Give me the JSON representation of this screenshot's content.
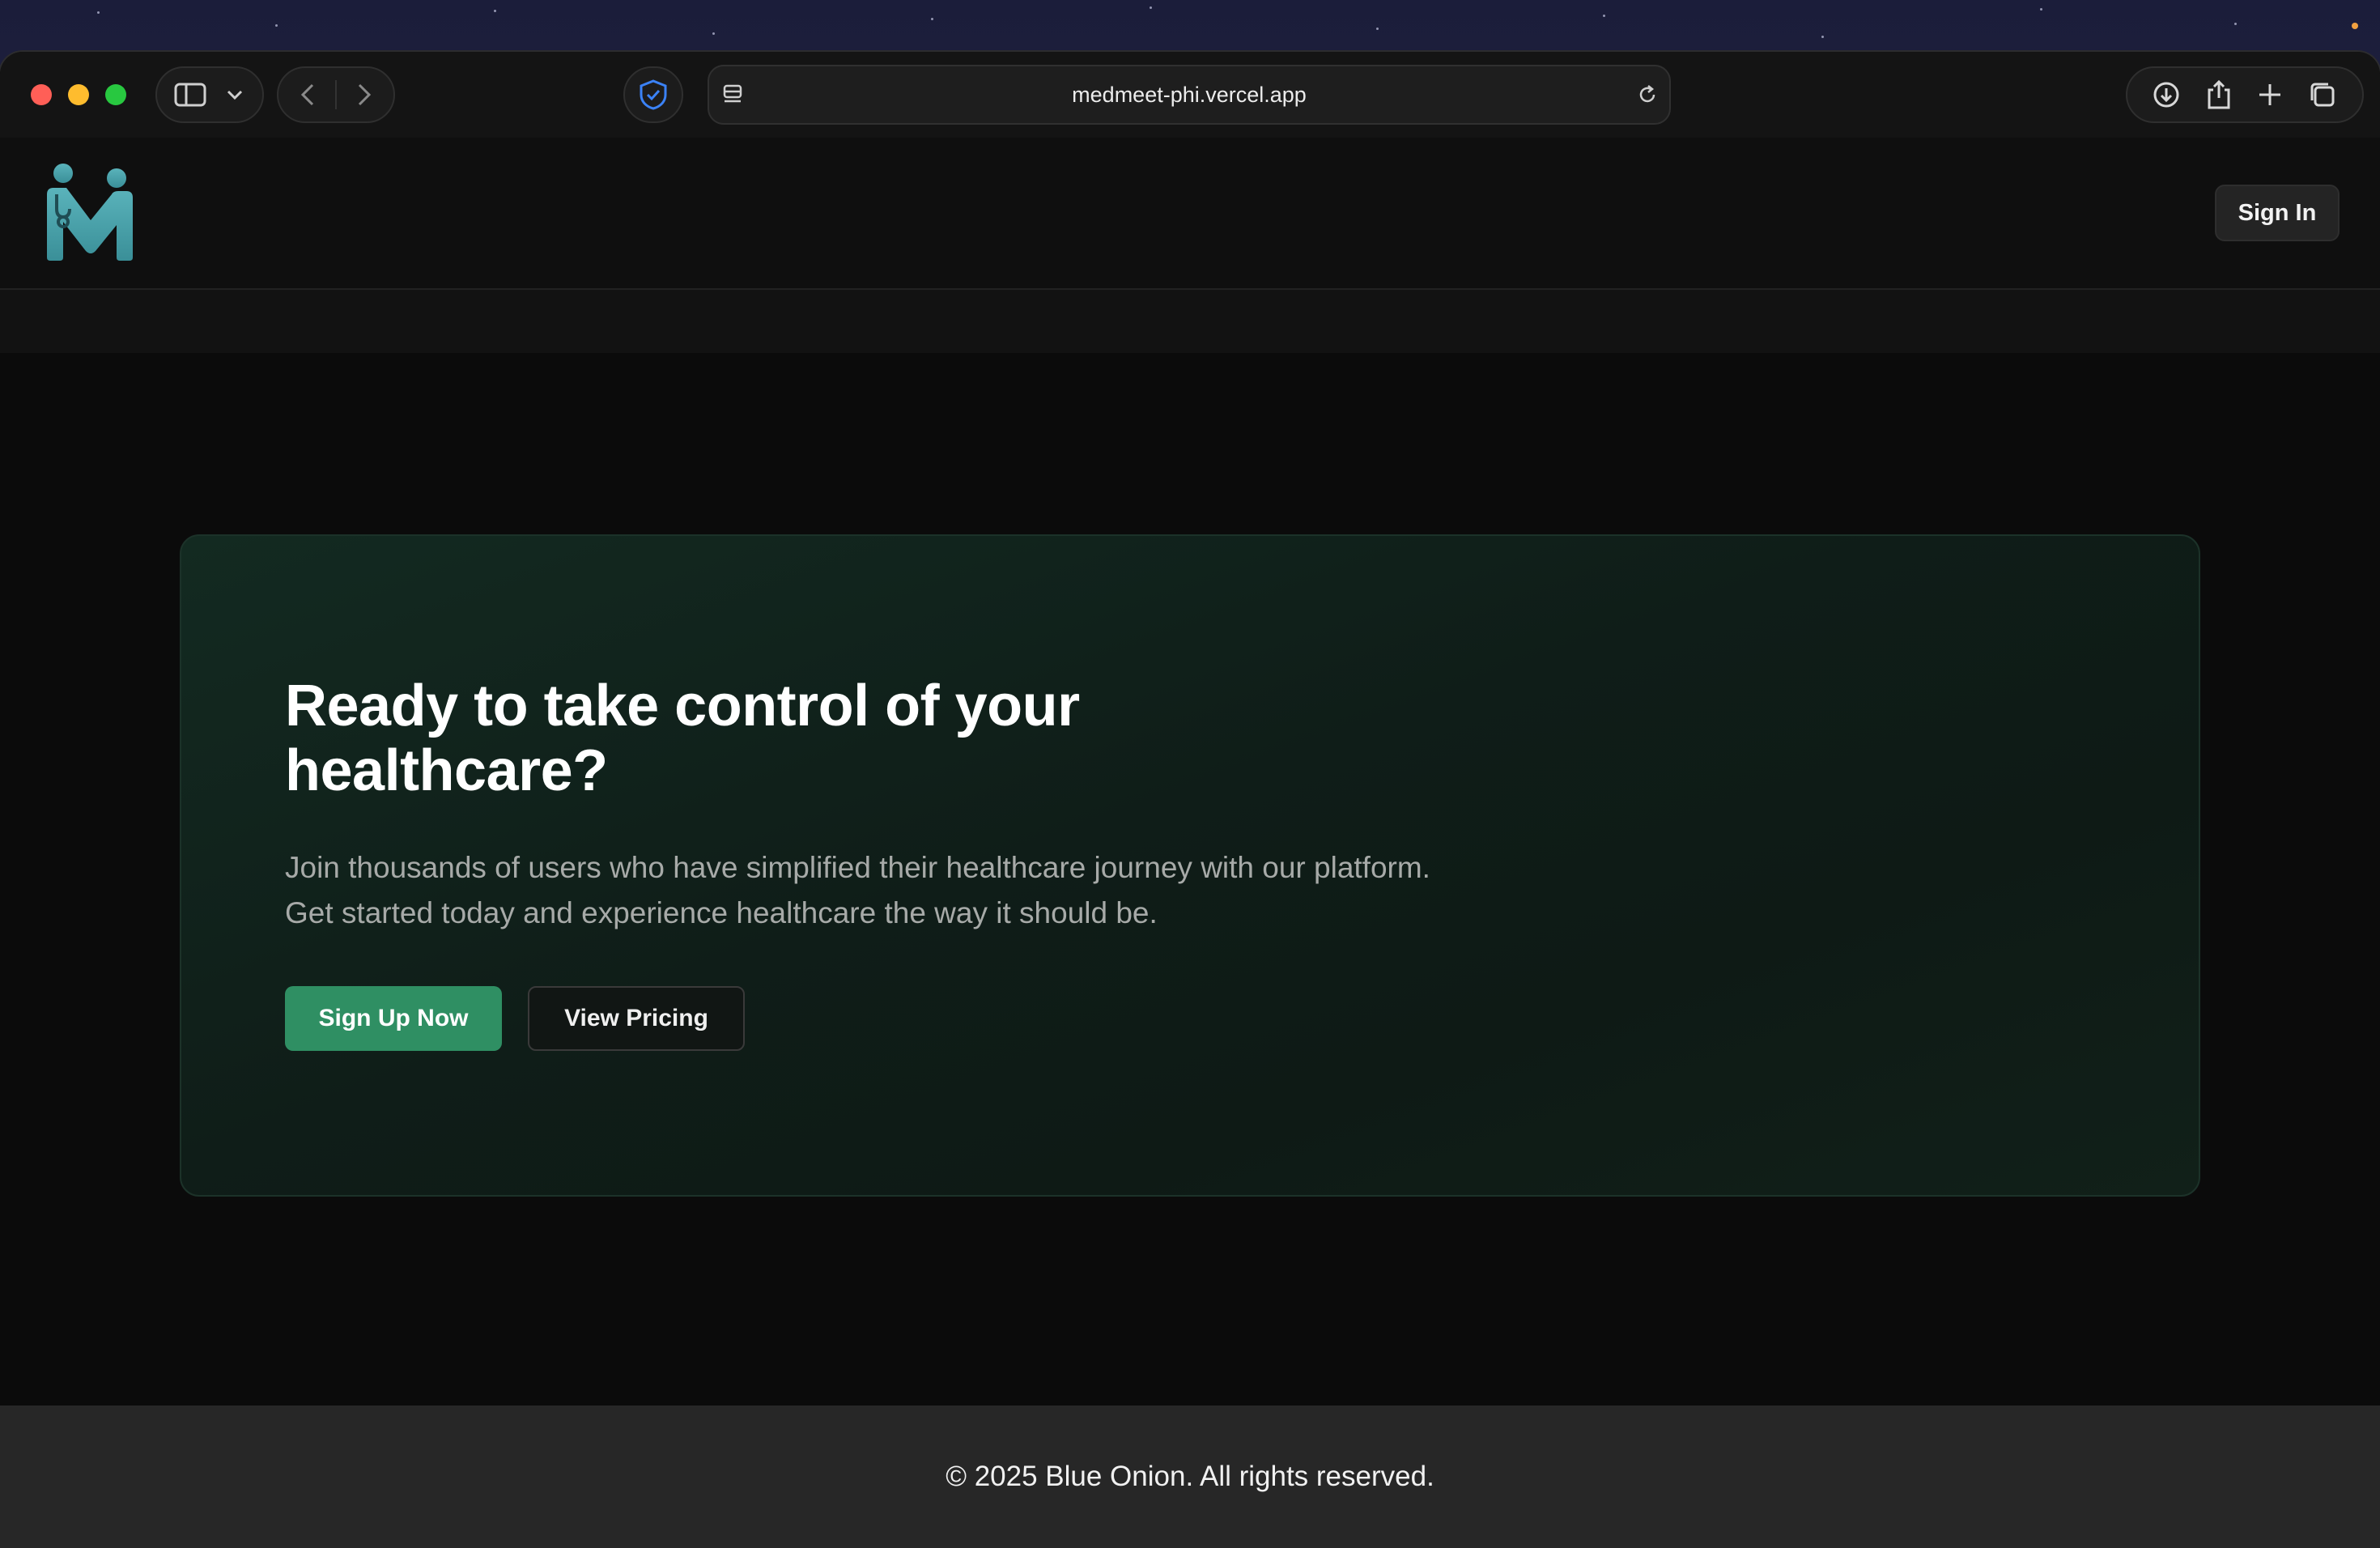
{
  "browser": {
    "url": "medmeet-phi.vercel.app",
    "colors": {
      "close": "#ff5f57",
      "minimize": "#febc2e",
      "zoom": "#28c840",
      "shield": "#3b82f6"
    }
  },
  "site": {
    "sign_in_label": "Sign In",
    "logo_colors": {
      "primary": "#4a9fa8",
      "dark": "#2d6f78"
    }
  },
  "cta": {
    "heading": "Ready to take control of your healthcare?",
    "description": "Join thousands of users who have simplified their healthcare journey with our platform. Get started today and experience healthcare the way it should be.",
    "primary_button": "Sign Up Now",
    "secondary_button": "View Pricing",
    "accent_color": "#2f8f63"
  },
  "footer": {
    "copyright": "© 2025 Blue Onion. All rights reserved."
  }
}
